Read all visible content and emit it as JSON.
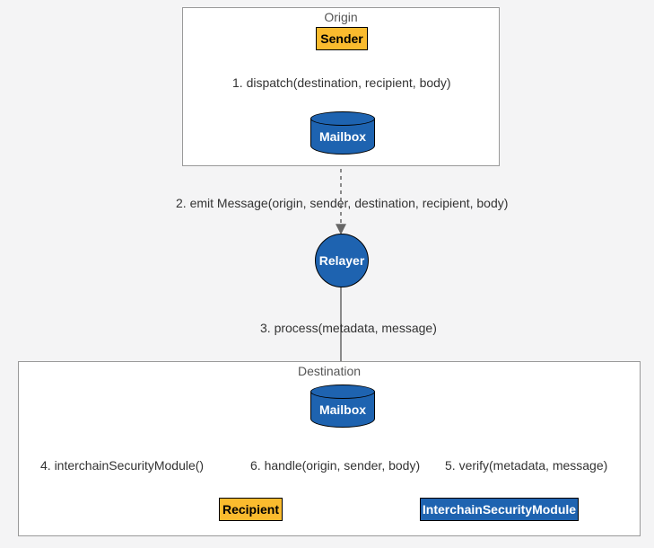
{
  "diagram": {
    "groups": {
      "origin": {
        "title": "Origin"
      },
      "destination": {
        "title": "Destination"
      }
    },
    "nodes": {
      "sender": {
        "label": "Sender"
      },
      "mailbox1": {
        "label": "Mailbox"
      },
      "relayer": {
        "label": "Relayer"
      },
      "mailbox2": {
        "label": "Mailbox"
      },
      "recipient": {
        "label": "Recipient"
      },
      "ism": {
        "label": "InterchainSecurityModule"
      }
    },
    "edges": {
      "e1": {
        "label": "1. dispatch(destination, recipient, body)"
      },
      "e2": {
        "label": "2. emit Message(origin, sender, destination, recipient, body)"
      },
      "e3": {
        "label": "3. process(metadata, message)"
      },
      "e4": {
        "label": "4. interchainSecurityModule()"
      },
      "e5": {
        "label": "5. verify(metadata, message)"
      },
      "e6": {
        "label": "6. handle(origin, sender, body)"
      }
    },
    "colors": {
      "brandBlue": "#1e63b0",
      "brandYellow": "#fabb2e"
    }
  }
}
